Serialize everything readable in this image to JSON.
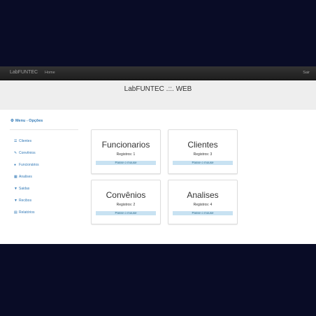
{
  "navbar": {
    "brand": "LabFUNTEC",
    "home": "Home",
    "logout": "Sair"
  },
  "header": {
    "title": "LabFUNTEC .::. WEB"
  },
  "sidebar": {
    "title": "Menu - Opções",
    "items": [
      {
        "label": "Clientes",
        "icon": "list-icon"
      },
      {
        "label": "Convênios",
        "icon": "wrench-icon"
      },
      {
        "label": "Funcionários",
        "icon": "user-icon"
      },
      {
        "label": "Analises",
        "icon": "th-list-icon"
      },
      {
        "label": "Saidas",
        "icon": "cart-icon"
      },
      {
        "label": "Recibos",
        "icon": "cart-icon"
      },
      {
        "label": "Relatórios",
        "icon": "calendar-icon"
      }
    ]
  },
  "cards": [
    {
      "title": "Funcionarios",
      "count": "Registros: 1",
      "hover": "Passe o mouse"
    },
    {
      "title": "Clientes",
      "count": "Registros: 3",
      "hover": "Passe o mouse"
    },
    {
      "title": "Convênios",
      "count": "Registros: 2",
      "hover": "Passe o mouse"
    },
    {
      "title": "Analises",
      "count": "Registros: 4",
      "hover": "Passe o mouse"
    }
  ],
  "colors": {
    "page_bg": "#090c26",
    "navbar": "#222222",
    "link": "#337ab7",
    "hover_bar": "#c8e2f2"
  }
}
